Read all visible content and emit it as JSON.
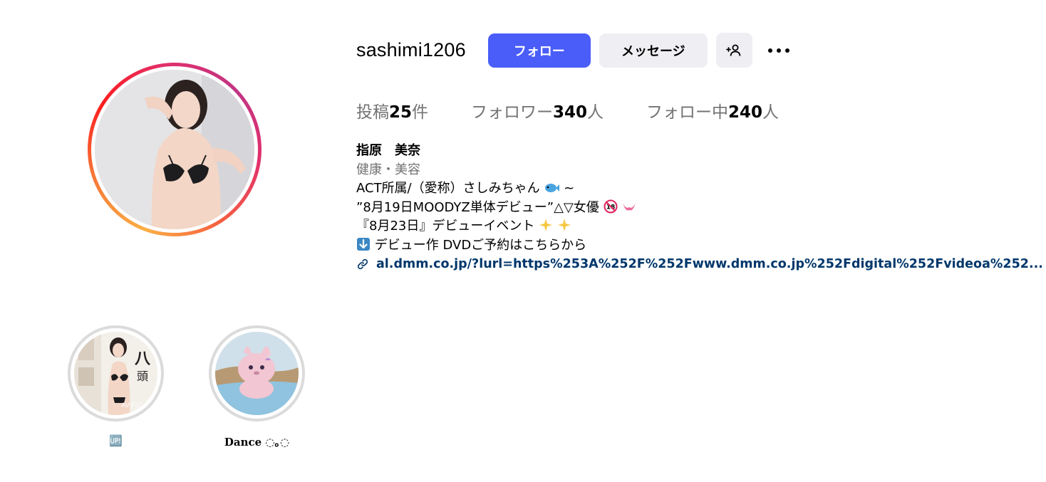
{
  "profile": {
    "username": "sashimi1206",
    "avatar_alt": "profile photo"
  },
  "actions": {
    "follow_label": "フォロー",
    "message_label": "メッセージ",
    "add_user_icon": "person-add-icon",
    "more_icon": "more-horizontal-icon"
  },
  "stats": {
    "posts_prefix": "投稿",
    "posts_count": "25",
    "posts_suffix": "件",
    "followers_prefix": "フォロワー",
    "followers_count": "340",
    "followers_suffix": "人",
    "following_prefix": "フォロー中",
    "following_count": "240",
    "following_suffix": "人"
  },
  "bio": {
    "name": "指原　美奈",
    "category": "健康・美容",
    "line1": "ACT所属/（愛称）さしみちゃん",
    "line1_tail": "~",
    "line2": "”8月19日MOODYZ単体デビュー”△▽女優",
    "line3": "『8月23日』デビューイベント",
    "line4": "デビュー作 DVDご予約はこちらから",
    "link": "al.dmm.co.jp/?lurl=https%253A%252F%252Fwww.dmm.co.jp%252Fdigital%252Fvideoa%252..."
  },
  "highlights": [
    {
      "label": "🆙"
    },
    {
      "label": "Dance ◌｡◌"
    }
  ],
  "colors": {
    "follow_bg": "#4a5df9",
    "secondary_bg": "#efeff3",
    "link": "#00376b",
    "muted": "#737373"
  }
}
